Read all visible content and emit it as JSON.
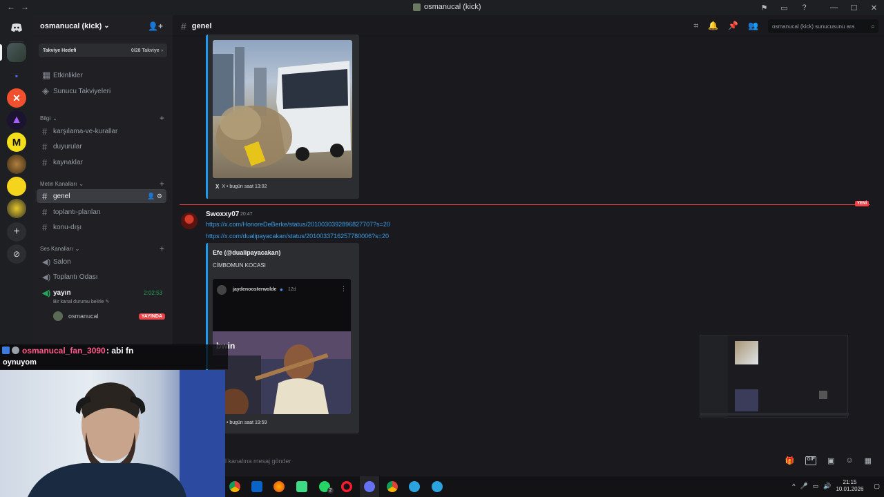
{
  "window": {
    "title": "osmanucal (kick)",
    "nav_back": "←",
    "nav_forward": "→",
    "controls": [
      "⚑",
      "▭",
      "?",
      "—",
      "☐",
      "✕"
    ]
  },
  "server_bar": {
    "add_label": "+",
    "discover_label": "⊘"
  },
  "guild": {
    "name": "osmanucal (kick)",
    "chevron": "⌄",
    "invite_icon": "👤+",
    "boost_label": "Takviye Hedefi",
    "boost_count": "0/28 Takviye",
    "boost_arrow": "›"
  },
  "channels": {
    "top": [
      {
        "icon": "▦",
        "label": "Etkinlikler"
      },
      {
        "icon": "◈",
        "label": "Sunucu Takviyeleri"
      }
    ],
    "cat_info": "Bilgi",
    "info_channels": [
      "karşılama-ve-kurallar",
      "duyurular",
      "kaynaklar"
    ],
    "cat_text": "Metin Kanalları",
    "text_channels": [
      "genel",
      "toplantı-planları",
      "konu-dışı"
    ],
    "active_controls": "👤 ⚙",
    "cat_voice": "Ses Kanalları",
    "voice_channels": [
      "Salon",
      "Toplantı Odası",
      "yayın"
    ],
    "voice_timer": "2:02:53",
    "voice_status": "Bir kanal durumu belirle",
    "voice_user": "osmanucal",
    "live_badge": "YAYINDA"
  },
  "header": {
    "hash": "#",
    "channel": "genel",
    "icons": [
      "⌗",
      "🔔",
      "📌",
      "👥"
    ],
    "search_placeholder": "osmanucal (kick) sunucusunu ara",
    "search_icon": "⌕"
  },
  "messages": {
    "embed1_footer": "X • bugün saat 13:02",
    "new_tag": "YENİ",
    "author": "Swoxxy07",
    "time": "20:47",
    "link1": "https://x.com/HonoreDeBerke/status/2010030392896827707?s=20",
    "link2": "https://x.com/dualipayacakan/status/2010033716257780006?s=20",
    "embed2_author": "Efe (@dualipayacakan)",
    "embed2_text": "CİMBOMUN KOCASI",
    "embed2_inner_user": "jaydenoosterwolde",
    "embed2_inner_time": "12d",
    "embed2_footer": "X • bugün saat 19:59",
    "x_logo": "X"
  },
  "composer": {
    "placeholder": "l kanalına mesaj gönder",
    "icons": [
      "🎁",
      "GIF",
      "▣",
      "☺",
      "▦"
    ]
  },
  "stream_chat": {
    "user": "osmanucal_fan_3090",
    "line1": ": abi fn",
    "line2": "oynuyom"
  },
  "taskbar": {
    "time": "21:15",
    "date": "10.01.2026",
    "tray_icons": [
      "^",
      "🎤",
      "▭",
      "🔊",
      "▢"
    ],
    "whatsapp_badge": "2"
  },
  "colors": {
    "accent": "#5865f2",
    "link": "#3c9ee4",
    "new_line": "#f23f43",
    "online": "#23a55a",
    "chat_name": "#ff5a8a"
  }
}
